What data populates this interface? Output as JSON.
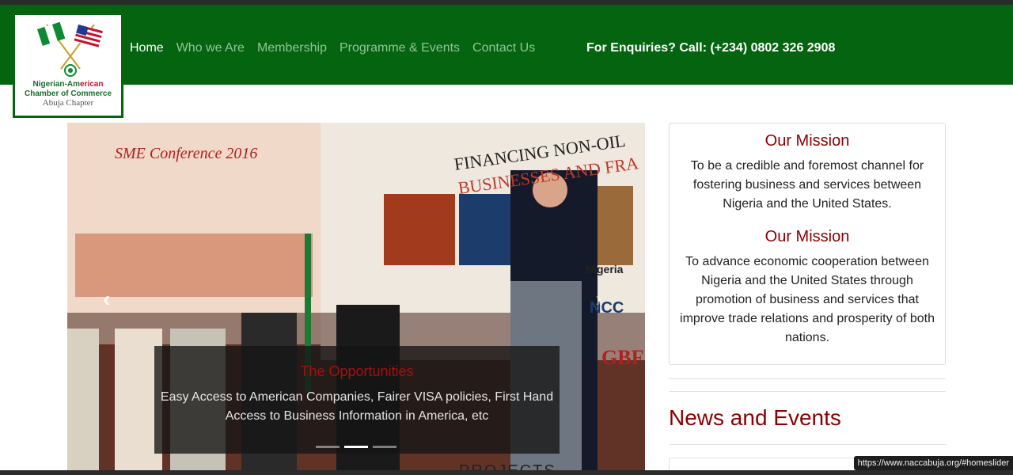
{
  "logo": {
    "line1_green": "Nigerian-Am",
    "line1_red": "erican",
    "line2": "Chamber of Commerce",
    "line3": "Abuja Chapter"
  },
  "nav": {
    "items": [
      "Home",
      "Who we Are",
      "Membership",
      "Programme & Events",
      "Contact Us"
    ],
    "active": "Home"
  },
  "enquiry": "For Enquiries? Call: (+234) 0802 326 2908",
  "slider": {
    "caption_title": "The Opportunities",
    "caption_text": "Easy Access to American Companies, Fairer VISA policies, First Hand Access to Business Information in America, etc",
    "indicator_count": 3,
    "active_indicator": 2,
    "prev_glyph": "‹",
    "next_glyph": "›",
    "banner_text": {
      "conference": "SME Conference 2016",
      "financing": "FINANCING NON-OIL",
      "businesses": "BUSINESSES AND FRA",
      "nigeria": "Nigeria",
      "ncc": "NCC",
      "gbf": "GBF"
    }
  },
  "mission": {
    "title1": "Our Mission",
    "text1": "To be a credible and foremost channel for fostering business and services between Nigeria and the United States.",
    "title2": "Our Mission",
    "text2": "To advance economic cooperation between Nigeria and the United States through promotion of business and services that improve trade relations and prosperity of both nations."
  },
  "news": {
    "title": "News and Events"
  },
  "projects": "PROJECTS",
  "status_url": "https://www.naccabuja.org/#homeslider",
  "colors": {
    "nav_green": "#056410",
    "mission_red": "#8b0000"
  }
}
